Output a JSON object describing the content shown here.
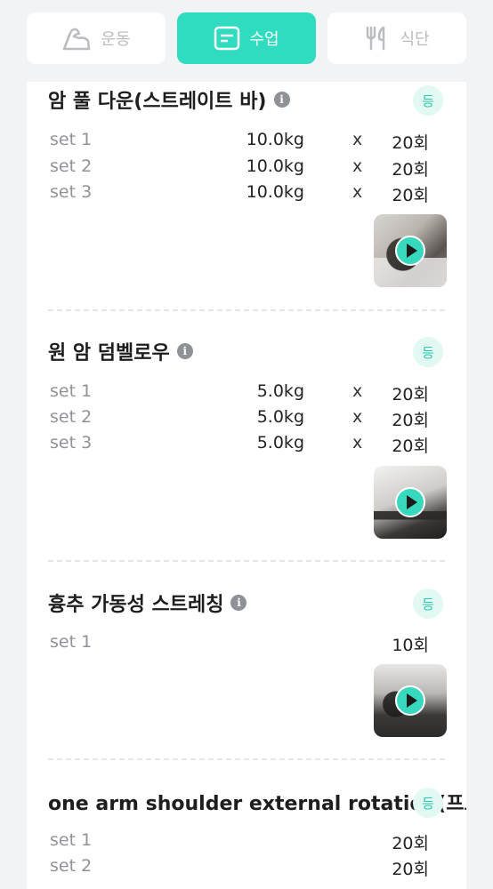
{
  "tabs": [
    {
      "label": "운동",
      "icon": "arm-muscle-icon",
      "active": false
    },
    {
      "label": "수업",
      "icon": "note-icon",
      "active": true
    },
    {
      "label": "식단",
      "icon": "fork-knife-icon",
      "active": false
    }
  ],
  "colors": {
    "accent": "#2fdcc0",
    "tag_bg": "#e2f8f3",
    "tag_text": "#2fc9ad",
    "page_bg": "#f2f3f4"
  },
  "exercises": [
    {
      "title": "암 풀 다운(스트레이트 바)",
      "tag": "등",
      "sets": [
        {
          "label": "set 1",
          "weight": "10.0kg",
          "x": "x",
          "reps": "20회"
        },
        {
          "label": "set 2",
          "weight": "10.0kg",
          "x": "x",
          "reps": "20회"
        },
        {
          "label": "set 3",
          "weight": "10.0kg",
          "x": "x",
          "reps": "20회"
        }
      ]
    },
    {
      "title": "원 암 덤벨로우",
      "tag": "등",
      "sets": [
        {
          "label": "set 1",
          "weight": "5.0kg",
          "x": "x",
          "reps": "20회"
        },
        {
          "label": "set 2",
          "weight": "5.0kg",
          "x": "x",
          "reps": "20회"
        },
        {
          "label": "set 3",
          "weight": "5.0kg",
          "x": "x",
          "reps": "20회"
        }
      ]
    },
    {
      "title": "흉추 가동성 스트레칭",
      "tag": "등",
      "sets": [
        {
          "label": "set 1",
          "reps": "10회"
        }
      ]
    },
    {
      "title": "one arm shoulder external rotation(프로)",
      "tag": "등",
      "sets": [
        {
          "label": "set 1",
          "reps": "20회"
        },
        {
          "label": "set 2",
          "reps": "20회"
        }
      ]
    }
  ]
}
